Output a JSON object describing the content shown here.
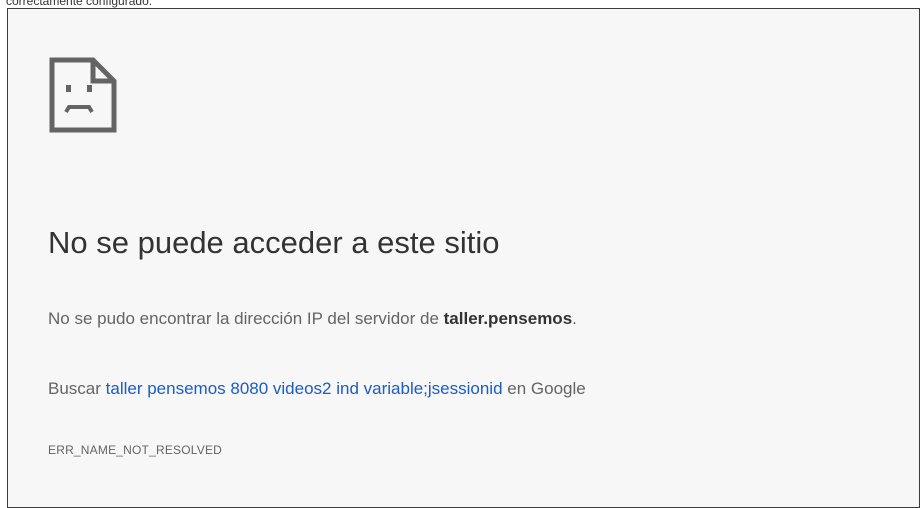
{
  "caption": {
    "text": "correctamente configurado."
  },
  "error_page": {
    "icon": "sad-page-icon",
    "title": "No se puede acceder a este sitio",
    "message_prefix": "No se pudo encontrar la dirección IP del servidor de ",
    "host": "taller.pensemos",
    "message_suffix": ".",
    "search_prefix": "Buscar ",
    "search_link": "taller pensemos 8080 videos2 ind variable;jsessionid",
    "search_suffix": " en Google",
    "error_code": "ERR_NAME_NOT_RESOLVED"
  },
  "colors": {
    "background": "#f7f7f7",
    "title": "#333333",
    "body_text": "#646464",
    "link": "#1a5cc8",
    "border": "#3c3c3c"
  }
}
